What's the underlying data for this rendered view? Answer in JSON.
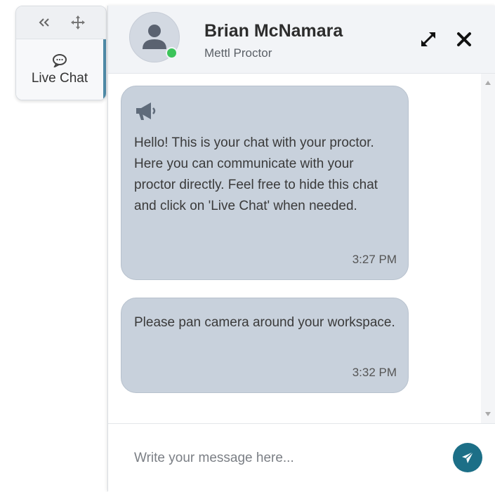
{
  "sidetab": {
    "collapse_icon": "double-chevron-left-icon",
    "move_icon": "move-arrows-icon",
    "live_chat_icon": "chat-bubble-icon",
    "live_chat_label": "Live Chat"
  },
  "header": {
    "name": "Brian McNamara",
    "role": "Mettl Proctor",
    "status": "online",
    "status_color": "#3cc45a"
  },
  "messages": [
    {
      "icon": "megaphone-icon",
      "text": "Hello! This is your chat with your proctor. Here you can communicate with your proctor directly. Feel free to hide this chat and click on 'Live Chat' when needed.",
      "time": "3:27 PM"
    },
    {
      "text": "Please pan camera around your workspace.",
      "time": "3:32 PM"
    }
  ],
  "composer": {
    "placeholder": "Write your message here...",
    "send_icon": "send-icon"
  },
  "colors": {
    "bubble": "#c8d1dc",
    "accent": "#1c6f87",
    "tab_indicator": "#4f8aa6"
  }
}
